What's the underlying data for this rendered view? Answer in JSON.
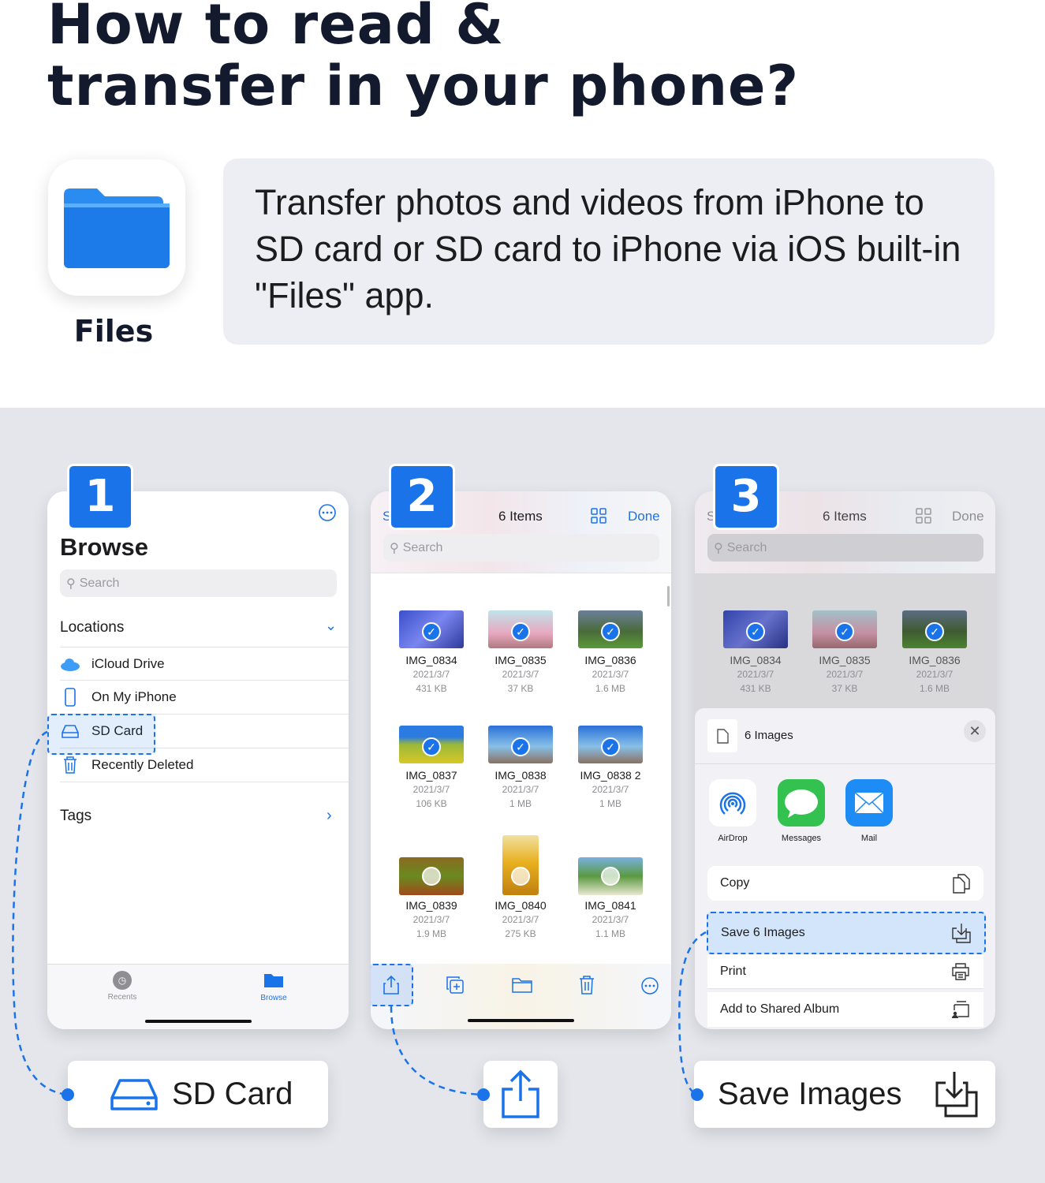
{
  "header": {
    "title_line1": "How to read &",
    "title_line2": "transfer in your phone?",
    "app_label": "Files",
    "description": "Transfer photos and videos from iPhone to SD card or SD card to iPhone via iOS built-in \"Files\" app."
  },
  "colors": {
    "accent": "#1a73e8",
    "panel_bg": "#e4e6ec",
    "highlight": "#d3e5fb"
  },
  "step1": {
    "number": "1",
    "title": "Browse",
    "search_placeholder": "Search",
    "locations_label": "Locations",
    "locations": [
      {
        "label": "iCloud Drive",
        "icon": "cloud-icon"
      },
      {
        "label": "On My iPhone",
        "icon": "phone-icon"
      },
      {
        "label": "SD Card",
        "icon": "drive-icon"
      },
      {
        "label": "Recently Deleted",
        "icon": "trash-icon"
      }
    ],
    "tags_label": "Tags",
    "tabs": [
      {
        "label": "Recents",
        "icon": "clock-icon"
      },
      {
        "label": "Browse",
        "icon": "folder-icon"
      }
    ]
  },
  "step2": {
    "number": "2",
    "partial_back": "S",
    "items_label": "6 Items",
    "done_label": "Done",
    "search_placeholder": "Search",
    "files": [
      {
        "name": "IMG_0834",
        "date": "2021/3/7",
        "size": "431 KB",
        "selected": true
      },
      {
        "name": "IMG_0835",
        "date": "2021/3/7",
        "size": "37 KB",
        "selected": true
      },
      {
        "name": "IMG_0836",
        "date": "2021/3/7",
        "size": "1.6 MB",
        "selected": true
      },
      {
        "name": "IMG_0837",
        "date": "2021/3/7",
        "size": "106 KB",
        "selected": true
      },
      {
        "name": "IMG_0838",
        "date": "2021/3/7",
        "size": "1 MB",
        "selected": true
      },
      {
        "name": "IMG_0838 2",
        "date": "2021/3/7",
        "size": "1 MB",
        "selected": true
      },
      {
        "name": "IMG_0839",
        "date": "2021/3/7",
        "size": "1.9 MB",
        "selected": false
      },
      {
        "name": "IMG_0840",
        "date": "2021/3/7",
        "size": "275 KB",
        "selected": false
      },
      {
        "name": "IMG_0841",
        "date": "2021/3/7",
        "size": "1.1 MB",
        "selected": false
      }
    ],
    "toolbar": [
      "share-icon",
      "duplicate-icon",
      "folder-icon",
      "trash-icon",
      "more-icon"
    ]
  },
  "step3": {
    "number": "3",
    "partial_back": "S",
    "items_label": "6 Items",
    "done_label": "Done",
    "search_placeholder": "Search",
    "sheet_title": "6 Images",
    "apps": [
      {
        "label": "AirDrop"
      },
      {
        "label": "Messages"
      },
      {
        "label": "Mail"
      }
    ],
    "actions": [
      {
        "label": "Copy",
        "icon": "copy-icon"
      },
      {
        "label": "Save 6 Images",
        "icon": "save-icon",
        "highlighted": true
      },
      {
        "label": "Print",
        "icon": "print-icon"
      },
      {
        "label": "Add to Shared Album",
        "icon": "shared-album-icon"
      }
    ]
  },
  "callouts": {
    "sd_card": "SD Card",
    "save_images": "Save Images"
  }
}
